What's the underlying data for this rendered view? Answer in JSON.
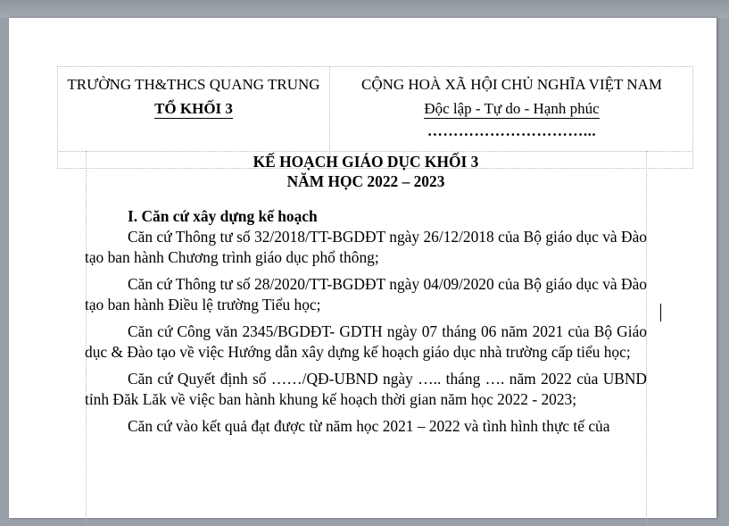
{
  "header": {
    "school": "TRƯỜNG TH&THCS QUANG TRUNG",
    "group": "TỔ KHỐI 3",
    "country": "CỘNG HOÀ XÃ HỘI CHỦ NGHĨA VIỆT NAM",
    "motto": "Độc lập - Tự do - Hạnh phúc",
    "dots": "…………………………..."
  },
  "document": {
    "title_line1": "KẾ HOẠCH GIÁO DỤC KHỐI 3",
    "title_line2": "NĂM HỌC 2022 – 2023",
    "section1": "I. Căn cứ xây dựng kế hoạch",
    "paragraphs": [
      "Căn cứ Thông tư số 32/2018/TT-BGDĐT ngày 26/12/2018 của Bộ giáo dục và Đào tạo ban hành Chương trình giáo dục  phổ thông;",
      "Căn cứ Thông tư số 28/2020/TT-BGDĐT ngày 04/09/2020 của Bộ giáo dục và Đào tạo ban hành Điều lệ trường Tiểu học;",
      "Căn cứ Công văn 2345/BGDĐT- GDTH ngày 07 tháng 06 năm 2021 của Bộ Giáo dục & Đào tạo về việc Hướng dẫn xây dựng kế hoạch giáo dục nhà trường cấp tiểu học;",
      "Căn cứ Quyết định số ……/QĐ-UBND ngày ….. tháng …. năm 2022 của UBND tỉnh Đăk Lăk về việc ban hành khung kế hoạch thời gian năm học 2022 - 2023;",
      "Căn cứ vào kết quả đạt được từ năm học 2021 – 2022 và tình hình thực tế của"
    ]
  }
}
